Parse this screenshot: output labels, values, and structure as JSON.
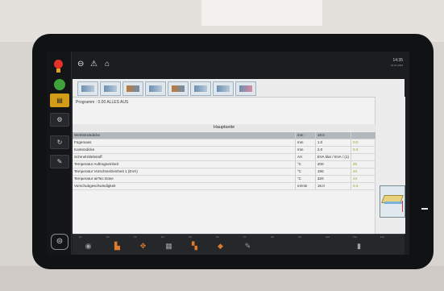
{
  "program": {
    "label": "Programm : 0.00   ALLES AUS"
  },
  "page": {
    "title": "Hauptseite"
  },
  "params": [
    {
      "name": "Werkstückdicke",
      "unit": "mm",
      "value": "19.0",
      "value2": "",
      "selected": true
    },
    {
      "name": "Fügemass",
      "unit": "mm",
      "value": "1.0",
      "value2": "0.0",
      "selected": false
    },
    {
      "name": "Kantendicke",
      "unit": "mm",
      "value": "2.0",
      "value2": "0.0",
      "selected": false
    },
    {
      "name": "Schmelzklebstoff",
      "unit": "Art",
      "value": "EVA klar / EVA / (1)",
      "value2": "",
      "selected": false
    },
    {
      "name": "Temperatur Auftragseinheit",
      "unit": "°C",
      "value": "200",
      "value2": "25",
      "selected": false
    },
    {
      "name": "Temperatur Vorschmelzeinheit 1 (EVA)",
      "unit": "°C",
      "value": "190",
      "value2": "24",
      "selected": false
    },
    {
      "name": "Temperatur airTec Düse",
      "unit": "°C",
      "value": "320",
      "value2": "24",
      "selected": false
    },
    {
      "name": "Vorschubgeschwindigkeit",
      "unit": "m/min",
      "value": "18.0",
      "value2": "0.0",
      "selected": false
    }
  ],
  "status": {
    "time": "14:35",
    "date": "01.01.2023"
  },
  "scale": [
    "F1",
    "F2",
    "F3",
    "F4",
    "F5",
    "F6",
    "F7",
    "F8",
    "F9",
    "F10",
    "F11",
    "F12"
  ],
  "icons": {
    "top": [
      "stop-icon",
      "warning-icon",
      "home-icon"
    ],
    "toolbar": [
      "glue-unit-icon",
      "snipping-icon",
      "feed-icon",
      "trimming-icon",
      "corner-icon",
      "profile-icon",
      "scraper-icon",
      "buffing-icon"
    ],
    "bottom": [
      "settings-icon",
      "gluing-icon",
      "tools-icon",
      "edge-icon",
      "scraper-icon",
      "buffing-icon",
      "info-icon",
      "next-icon"
    ]
  },
  "colors": {
    "stop": "#e53228",
    "ok": "#3fa33a",
    "accent": "#d29c17",
    "value_green": "#8aa51e"
  }
}
